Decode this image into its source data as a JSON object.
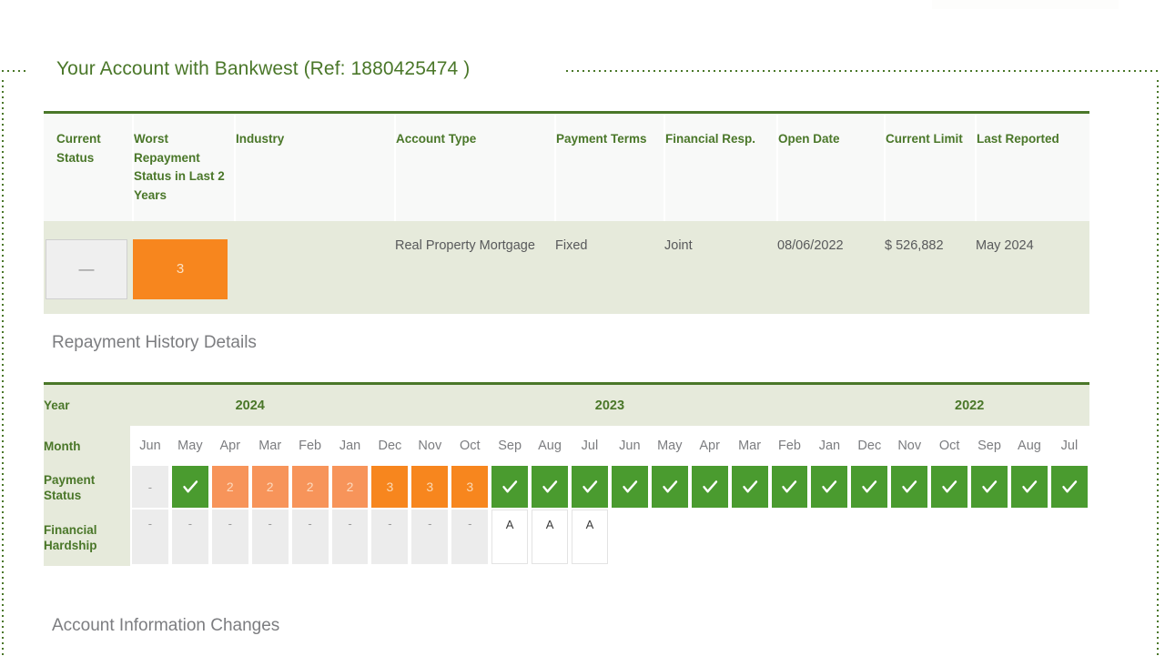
{
  "page_title": "Your Account with Bankwest (Ref: 1880425474 )",
  "colors": {
    "brand_green": "#4a7729",
    "badge_green": "#4a9b2f",
    "badge_orange_light": "#f7945a",
    "badge_orange_dark": "#f7861e",
    "header_bg": "#e6eadb",
    "muted_text": "#7c7d80"
  },
  "account_table": {
    "headers": [
      "Current Status",
      "Worst Repayment Status in Last 2 Years",
      "Industry",
      "Account Type",
      "Payment Terms",
      "Financial Resp.",
      "Open Date",
      "Current Limit",
      "Last Reported"
    ],
    "row": {
      "current_status": "—",
      "worst_repayment_status": "3",
      "industry": "",
      "account_type": "Real Property Mortgage",
      "payment_terms": "Fixed",
      "financial_resp": "Joint",
      "open_date": "08/06/2022",
      "current_limit": "$ 526,882",
      "last_reported": "May 2024"
    }
  },
  "repayment_history": {
    "section_title": "Repayment History Details",
    "row_labels": {
      "year": "Year",
      "month": "Month",
      "payment_status": "Payment Status",
      "financial_hardship": "Financial Hardship"
    },
    "years": [
      {
        "label": "2024",
        "span": 6
      },
      {
        "label": "2023",
        "span": 12
      },
      {
        "label": "2022",
        "span": 6
      }
    ],
    "months": [
      "Jun",
      "May",
      "Apr",
      "Mar",
      "Feb",
      "Jan",
      "Dec",
      "Nov",
      "Oct",
      "Sep",
      "Aug",
      "Jul",
      "Jun",
      "May",
      "Apr",
      "Mar",
      "Feb",
      "Jan",
      "Dec",
      "Nov",
      "Oct",
      "Sep",
      "Aug",
      "Jul"
    ],
    "payment_status": [
      "-",
      "ok",
      "2",
      "2",
      "2",
      "2",
      "3",
      "3",
      "3",
      "ok",
      "ok",
      "ok",
      "ok",
      "ok",
      "ok",
      "ok",
      "ok",
      "ok",
      "ok",
      "ok",
      "ok",
      "ok",
      "ok",
      "ok"
    ],
    "financial_hardship": [
      "-",
      "-",
      "-",
      "-",
      "-",
      "-",
      "-",
      "-",
      "-",
      "A",
      "A",
      "A",
      "",
      "",
      "",
      "",
      "",
      "",
      "",
      "",
      "",
      "",
      "",
      ""
    ]
  },
  "account_information_changes": {
    "section_title": "Account Information Changes"
  }
}
